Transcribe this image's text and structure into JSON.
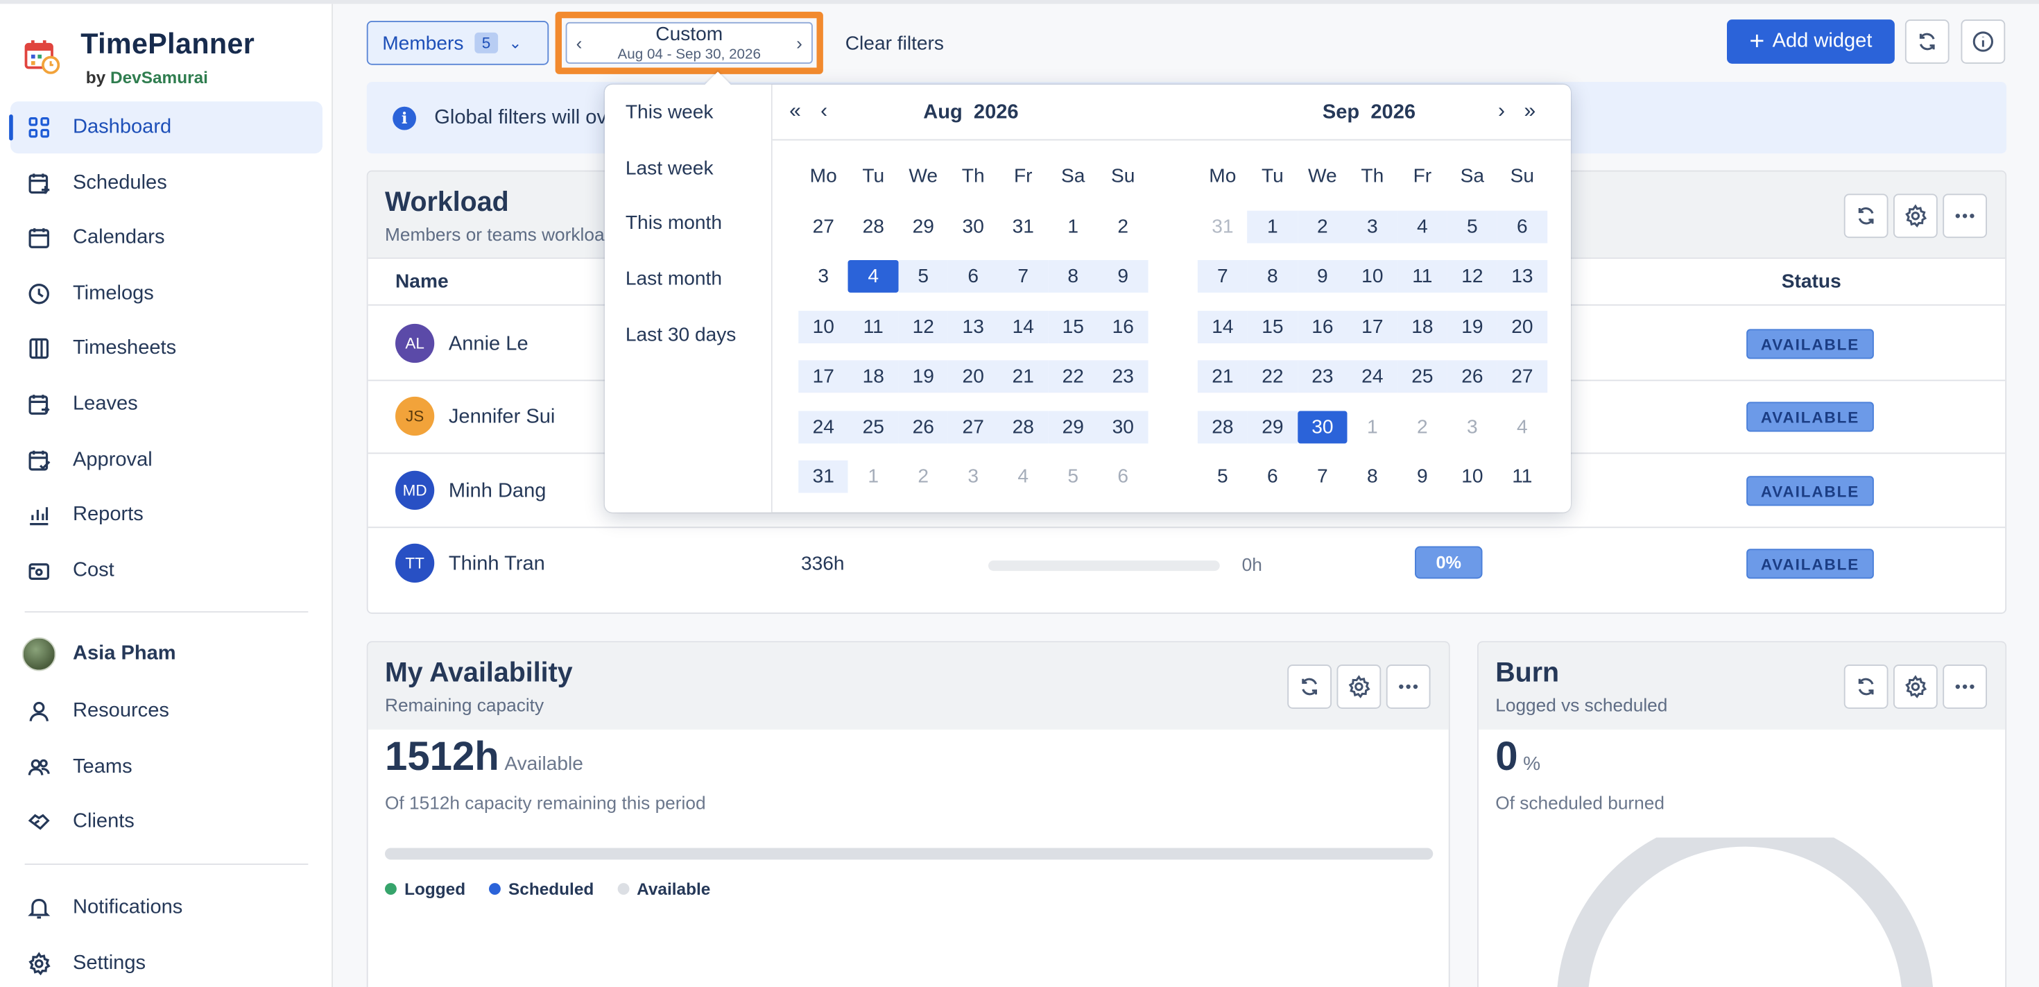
{
  "brand": {
    "title": "TimePlanner",
    "by": "by",
    "by_name": "DevSamurai"
  },
  "sidebar": {
    "items": [
      {
        "label": "Dashboard",
        "icon": "dashboard-icon",
        "active": true
      },
      {
        "label": "Schedules",
        "icon": "calendar-plus-icon"
      },
      {
        "label": "Calendars",
        "icon": "calendar-icon"
      },
      {
        "label": "Timelogs",
        "icon": "clock-icon"
      },
      {
        "label": "Timesheets",
        "icon": "timesheet-icon"
      },
      {
        "label": "Leaves",
        "icon": "leave-icon"
      },
      {
        "label": "Approval",
        "icon": "approval-icon"
      },
      {
        "label": "Reports",
        "icon": "bar-chart-icon"
      },
      {
        "label": "Cost",
        "icon": "cost-icon"
      }
    ],
    "user": {
      "name": "Asia Pham"
    },
    "people": [
      {
        "label": "Resources",
        "icon": "person-icon"
      },
      {
        "label": "Teams",
        "icon": "team-icon"
      },
      {
        "label": "Clients",
        "icon": "handshake-icon"
      }
    ],
    "bottom": [
      {
        "label": "Notifications",
        "icon": "bell-icon"
      },
      {
        "label": "Settings",
        "icon": "gear-icon"
      }
    ]
  },
  "toolbar": {
    "members_label": "Members",
    "members_count": "5",
    "custom_label": "Custom",
    "custom_range": "Aug 04 - Sep 30, 2026",
    "clear_label": "Clear filters",
    "add_widget_label": "Add widget"
  },
  "banner": {
    "text": "Global filters will ov"
  },
  "workload": {
    "title": "Workload",
    "subtitle": "Members or teams workloa",
    "col_name": "Name",
    "col_status": "Status",
    "rows": [
      {
        "initials": "AL",
        "name": "Annie Le",
        "color": "#5b4aa8",
        "status": "AVAILABLE"
      },
      {
        "initials": "JS",
        "name": "Jennifer Sui",
        "color": "#f2a33a",
        "status": "AVAILABLE"
      },
      {
        "initials": "MD",
        "name": "Minh Dang",
        "color": "#2850c4",
        "status": "AVAILABLE"
      },
      {
        "initials": "TT",
        "name": "Thinh Tran",
        "color": "#2850c4",
        "status": "AVAILABLE",
        "capacity": "336h",
        "hours": "0h",
        "percent": "0%",
        "progress": 0
      }
    ]
  },
  "availability": {
    "title": "My Availability",
    "subtitle": "Remaining capacity",
    "value": "1512h",
    "unit": "Available",
    "desc": "Of 1512h capacity remaining this period",
    "legend": [
      {
        "label": "Logged",
        "color": "#36a46b"
      },
      {
        "label": "Scheduled",
        "color": "#2b63d9"
      },
      {
        "label": "Available",
        "color": "#dcdfe4"
      }
    ]
  },
  "burn": {
    "title": "Burn",
    "subtitle": "Logged vs scheduled",
    "value": "0",
    "unit": "%",
    "desc": "Of scheduled burned"
  },
  "datepicker": {
    "presets": [
      "This week",
      "Last week",
      "This month",
      "Last month",
      "Last 30 days"
    ],
    "weekdays": [
      "Mo",
      "Tu",
      "We",
      "Th",
      "Fr",
      "Sa",
      "Su"
    ],
    "left": {
      "month": "Aug",
      "year": "2026",
      "weeks": [
        [
          "27",
          "28",
          "29",
          "30",
          "31",
          "1",
          "2"
        ],
        [
          "3",
          "4",
          "5",
          "6",
          "7",
          "8",
          "9"
        ],
        [
          "10",
          "11",
          "12",
          "13",
          "14",
          "15",
          "16"
        ],
        [
          "17",
          "18",
          "19",
          "20",
          "21",
          "22",
          "23"
        ],
        [
          "24",
          "25",
          "26",
          "27",
          "28",
          "29",
          "30"
        ],
        [
          "31",
          "1",
          "2",
          "3",
          "4",
          "5",
          "6"
        ]
      ]
    },
    "right": {
      "month": "Sep",
      "year": "2026",
      "weeks": [
        [
          "31",
          "1",
          "2",
          "3",
          "4",
          "5",
          "6"
        ],
        [
          "7",
          "8",
          "9",
          "10",
          "11",
          "12",
          "13"
        ],
        [
          "14",
          "15",
          "16",
          "17",
          "18",
          "19",
          "20"
        ],
        [
          "21",
          "22",
          "23",
          "24",
          "25",
          "26",
          "27"
        ],
        [
          "28",
          "29",
          "30",
          "1",
          "2",
          "3",
          "4"
        ],
        [
          "5",
          "6",
          "7",
          "8",
          "9",
          "10",
          "11"
        ]
      ]
    },
    "range_start": "Aug 04 2026",
    "range_end": "Sep 30 2026"
  },
  "colors": {
    "accent": "#2b63d9",
    "highlight": "#f28a2e",
    "range": "#e9f0fd"
  }
}
